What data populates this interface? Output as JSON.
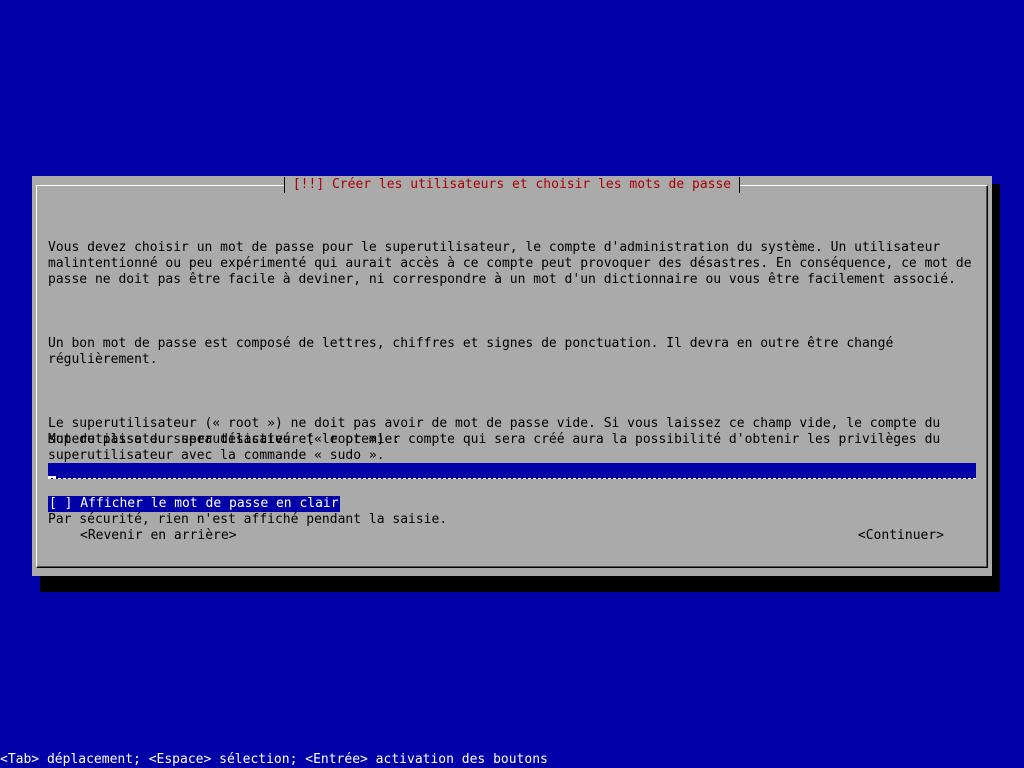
{
  "dialog": {
    "title": "[!!] Créer les utilisateurs et choisir les mots de passe",
    "paragraphs": [
      "Vous devez choisir un mot de passe pour le superutilisateur, le compte d'administration du système. Un utilisateur malintentionné ou peu expérimenté qui aurait accès à ce compte peut provoquer des désastres. En conséquence, ce mot de passe ne doit pas être facile à deviner, ni correspondre à un mot d'un dictionnaire ou vous être facilement associé.",
      "Un bon mot de passe est composé de lettres, chiffres et signes de ponctuation. Il devra en outre être changé régulièrement.",
      "Le superutilisateur (« root ») ne doit pas avoir de mot de passe vide. Si vous laissez ce champ vide, le compte du superutilisateur sera désactivé et le premier compte qui sera créé aura la possibilité d'obtenir les privilèges du superutilisateur avec la commande « sudo ».",
      "Par sécurité, rien n'est affiché pendant la saisie."
    ],
    "prompt_label": "Mot de passe du superutilisateur (« root ») :",
    "password_value": "",
    "show_password_checkbox": "[ ] Afficher le mot de passe en clair",
    "buttons": {
      "back": "<Revenir en arrière>",
      "continue": "<Continuer>"
    }
  },
  "statusbar": {
    "help": "<Tab> déplacement; <Espace> sélection; <Entrée> activation des boutons"
  },
  "colors": {
    "background": "#0000a8",
    "dialog": "#aaaaaa",
    "title": "#a80000",
    "highlight": "#0000a8",
    "text": "#000000",
    "highlight_text": "#ffffff"
  }
}
